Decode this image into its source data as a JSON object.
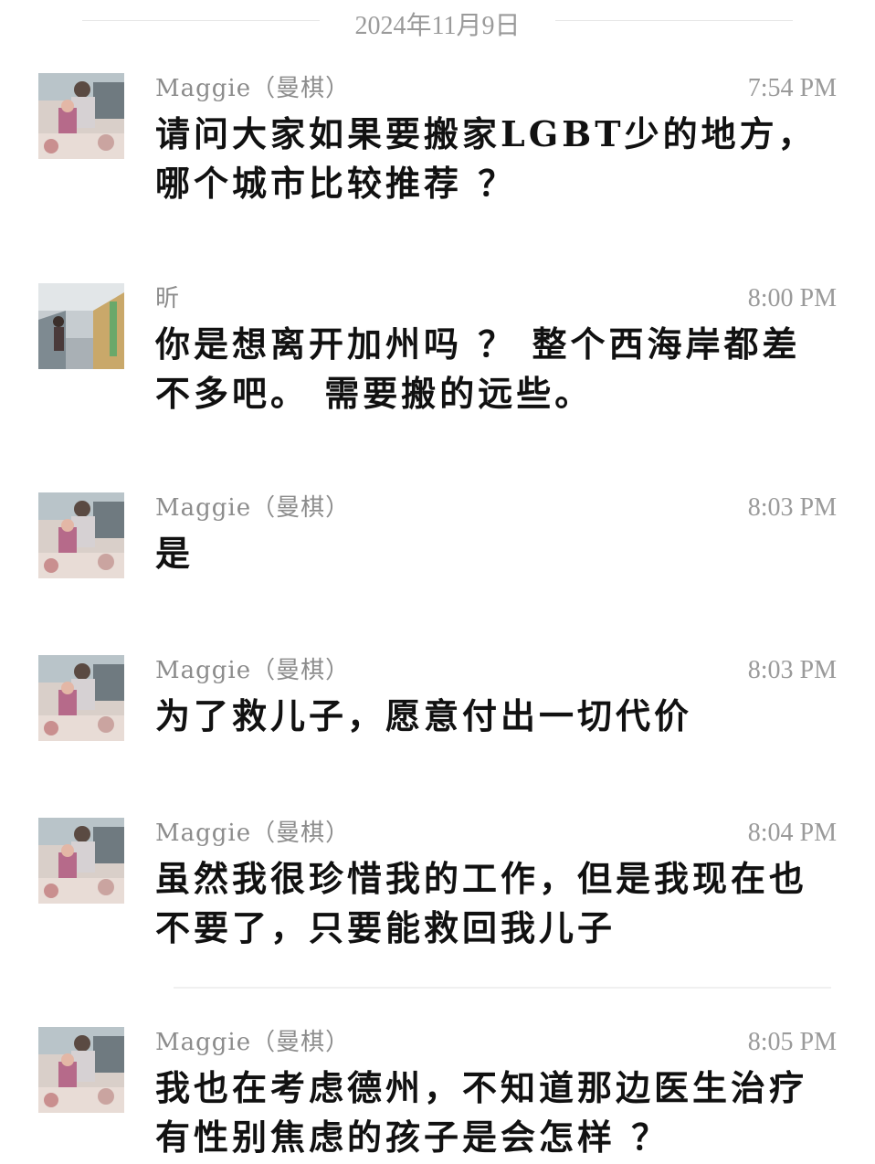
{
  "date_header": "2024年11月9日",
  "messages": [
    {
      "sender": "Maggie（曼棋）",
      "time": "7:54 PM",
      "text": "请问大家如果要搬家LGBT少的地方，哪个城市比较推荐 ？",
      "avatar": "mother-avatar"
    },
    {
      "sender": "昕",
      "time": "8:00 PM",
      "text": "你是想离开加州吗 ？ 整个西海岸都差不多吧。 需要搬的远些。",
      "avatar": "street-avatar"
    },
    {
      "sender": "Maggie（曼棋）",
      "time": "8:03 PM",
      "text": "是",
      "avatar": "mother-avatar"
    },
    {
      "sender": "Maggie（曼棋）",
      "time": "8:03 PM",
      "text": "为了救儿子，愿意付出一切代价",
      "avatar": "mother-avatar"
    },
    {
      "sender": "Maggie（曼棋）",
      "time": "8:04 PM",
      "text": "虽然我很珍惜我的工作，但是我现在也不要了，只要能救回我儿子",
      "avatar": "mother-avatar"
    },
    {
      "sender": "Maggie（曼棋）",
      "time": "8:05 PM",
      "text": "我也在考虑德州，不知道那边医生治疗有性别焦虑的孩子是会怎样 ？",
      "avatar": "mother-avatar"
    }
  ]
}
